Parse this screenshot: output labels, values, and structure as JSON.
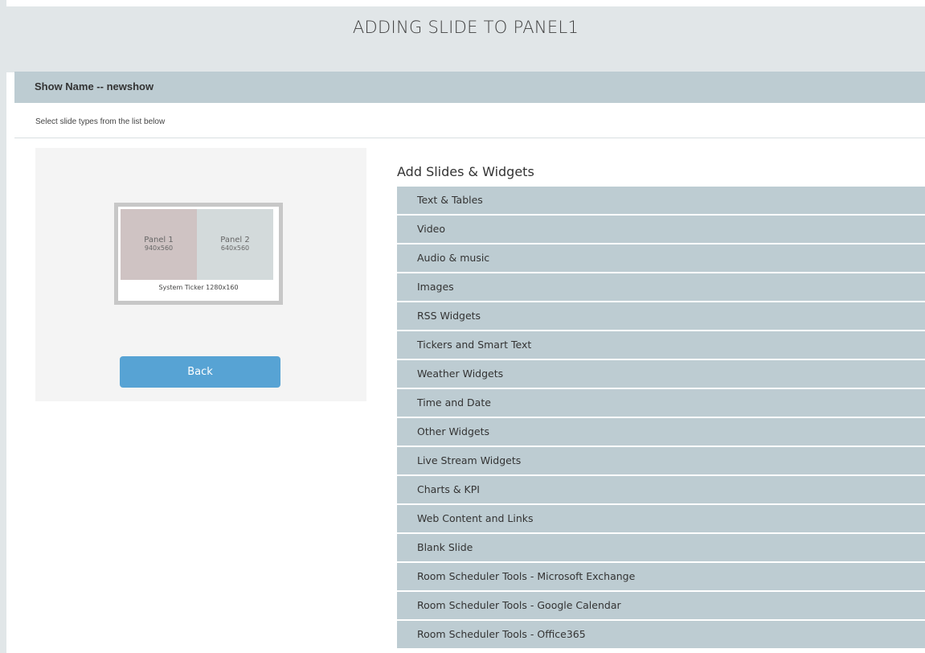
{
  "header": {
    "title": "ADDING SLIDE TO PANEL1"
  },
  "show_bar": {
    "label": "Show Name -- newshow"
  },
  "instruction": "Select slide types from the list below",
  "preview": {
    "panels": [
      {
        "name": "Panel 1",
        "size": "940x560"
      },
      {
        "name": "Panel 2",
        "size": "640x560"
      }
    ],
    "ticker": "System Ticker 1280x160",
    "back_label": "Back"
  },
  "widgets": {
    "title": "Add Slides & Widgets",
    "items": [
      {
        "label": "Text & Tables"
      },
      {
        "label": "Video"
      },
      {
        "label": "Audio & music"
      },
      {
        "label": "Images"
      },
      {
        "label": "RSS Widgets"
      },
      {
        "label": "Tickers and Smart Text"
      },
      {
        "label": "Weather Widgets"
      },
      {
        "label": "Time and Date"
      },
      {
        "label": "Other Widgets"
      },
      {
        "label": "Live Stream Widgets"
      },
      {
        "label": "Charts & KPI"
      },
      {
        "label": "Web Content and Links"
      },
      {
        "label": "Blank Slide"
      },
      {
        "label": "Room Scheduler Tools - Microsoft Exchange"
      },
      {
        "label": "Room Scheduler Tools - Google Calendar"
      },
      {
        "label": "Room Scheduler Tools - Office365"
      }
    ]
  },
  "colors": {
    "header_bg": "#e1e6e8",
    "bar_bg": "#bdccd2",
    "panel_1": "#cfc3c3",
    "panel_2": "#d3dadb",
    "back_button": "#57a3d4"
  }
}
